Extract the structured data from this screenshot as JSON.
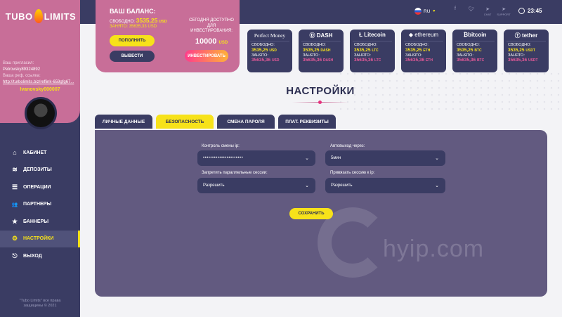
{
  "logo": {
    "left": "TUBO",
    "right": "LIMITS"
  },
  "partner": {
    "label1": "Ваш пригласил:",
    "inviter": "Petrovsky89324892",
    "label2": "Ваша реф. ссылка:",
    "ref_link": "http://turbolimits.biz/reflink-659gfg67..."
  },
  "username": "Ivanovsky000007",
  "nav": [
    {
      "label": "КАБИНЕТ",
      "icon": "home-icon",
      "glyph": "⌂"
    },
    {
      "label": "ДЕПОЗИТЫ",
      "icon": "stack-icon",
      "glyph": "≋"
    },
    {
      "label": "ОПЕРАЦИИ",
      "icon": "list-icon",
      "glyph": "☰"
    },
    {
      "label": "ПАРТНЕРЫ",
      "icon": "users-icon",
      "glyph": "👥"
    },
    {
      "label": "БАННЕРЫ",
      "icon": "star-icon",
      "glyph": "★"
    },
    {
      "label": "НАСТРОЙКИ",
      "icon": "gear-icon",
      "glyph": "⚙"
    },
    {
      "label": "ВЫХОД",
      "icon": "logout-icon",
      "glyph": "⎋"
    }
  ],
  "copyright": {
    "line1": "\"Tubo Limits\" все права",
    "line2": "защищены © 2021"
  },
  "balance": {
    "title": "ВАШ БАЛАНС:",
    "free_label": "СВОБОДНО:",
    "free_value": "3535,25",
    "free_currency": "USD",
    "busy_label": "ЗАНЯТО:",
    "busy_value": "35635,33 USD",
    "deposit_button": "ПОПОЛНИТЬ",
    "withdraw_button": "ВЫВЕСТИ",
    "invest_label": "СЕГОДНЯ ДОСТУПНО ДЛЯ ИНВЕСТИРОВАНИЯ:",
    "invest_amount": "10000",
    "invest_currency": "USD",
    "invest_button": "ИНВЕСТИРОВАТЬ"
  },
  "topbar": {
    "language": "RU",
    "social_chat": "CHAT",
    "social_support": "SUPPORT",
    "time": "23:45"
  },
  "coins": [
    {
      "name": "Perfect Money",
      "free": "3535,25",
      "free_cur": "USD",
      "busy": "35635,36",
      "busy_cur": "USD"
    },
    {
      "name": "DASH",
      "free": "3535,25",
      "free_cur": "DASH",
      "busy": "35635,36",
      "busy_cur": "DASH"
    },
    {
      "name": "Litecoin",
      "free": "3535,25",
      "free_cur": "LTC",
      "busy": "35635,36",
      "busy_cur": "LTC"
    },
    {
      "name": "ethereum",
      "free": "3535,25",
      "free_cur": "ETH",
      "busy": "35635,36",
      "busy_cur": "ETH"
    },
    {
      "name": "bitcoin",
      "free": "3535,25",
      "free_cur": "BTC",
      "busy": "35635,36",
      "busy_cur": "BTC"
    },
    {
      "name": "tether",
      "free": "3535,25",
      "free_cur": "USDT",
      "busy": "35635,36",
      "busy_cur": "USDT"
    }
  ],
  "coin_labels": {
    "free": "СВОБОДНО:",
    "busy": "ЗАНЯТО:"
  },
  "page_title": "НАСТРОЙКИ",
  "tabs": [
    "ЛИЧНЫЕ ДАННЫЕ",
    "БЕЗОПАСНОСТЬ",
    "СМЕНА ПАРОЛЯ",
    "ПЛАТ. РЕКВИЗИТЫ"
  ],
  "form": {
    "ip_label": "Контроль смены ip:",
    "ip_value": "••••••••••••••••••••••",
    "autologout_label": "Автовыход через:",
    "autologout_value": "5мин",
    "parallel_label": "Запретить параллельные сессии:",
    "parallel_value": "Разрешить",
    "bind_label": "Привязать сессию к ip:",
    "bind_value": "Разрешить",
    "save_button": "СОХРАНИТЬ"
  },
  "watermark": "hyip.com",
  "colors": {
    "accent": "#f7e21a",
    "pink": "#c86e98",
    "navy": "#3a3c63",
    "panel": "#625a80"
  }
}
